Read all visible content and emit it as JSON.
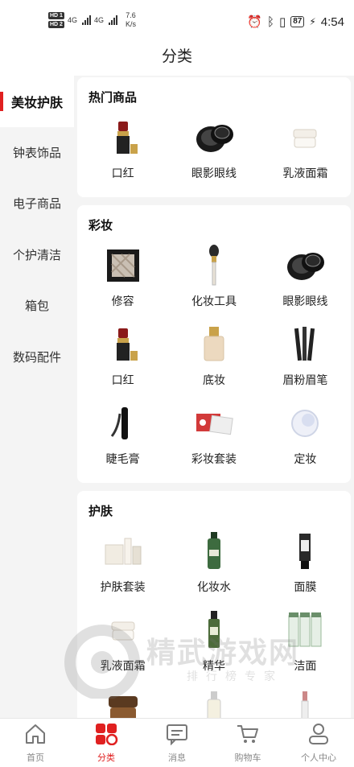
{
  "status_bar": {
    "hd1": "HD 1",
    "hd2": "HD 2",
    "net1": "4G",
    "net2": "4G",
    "speed_value": "7.6",
    "speed_unit": "K/s",
    "battery": "87",
    "time": "4:54"
  },
  "header": {
    "title": "分类"
  },
  "sidebar": {
    "items": [
      {
        "label": "美妆护肤",
        "active": true
      },
      {
        "label": "钟表饰品"
      },
      {
        "label": "电子商品"
      },
      {
        "label": "个护清洁"
      },
      {
        "label": "箱包"
      },
      {
        "label": "数码配件"
      }
    ]
  },
  "sections": [
    {
      "title": "热门商品",
      "items": [
        {
          "label": "口红",
          "icon": "lipstick-icon"
        },
        {
          "label": "眼影眼线",
          "icon": "eyeshadow-jar-icon"
        },
        {
          "label": "乳液面霜",
          "icon": "cream-jar-icon"
        }
      ]
    },
    {
      "title": "彩妆",
      "items": [
        {
          "label": "修容",
          "icon": "contour-palette-icon"
        },
        {
          "label": "化妆工具",
          "icon": "makeup-brush-icon"
        },
        {
          "label": "眼影眼线",
          "icon": "eyeshadow-jar-icon"
        },
        {
          "label": "口红",
          "icon": "lipstick-icon"
        },
        {
          "label": "底妆",
          "icon": "foundation-bottle-icon"
        },
        {
          "label": "眉粉眉笔",
          "icon": "brow-pencils-icon"
        },
        {
          "label": "睫毛膏",
          "icon": "mascara-icon"
        },
        {
          "label": "彩妆套装",
          "icon": "makeup-set-icon"
        },
        {
          "label": "定妆",
          "icon": "powder-puff-icon"
        }
      ]
    },
    {
      "title": "护肤",
      "items": [
        {
          "label": "护肤套装",
          "icon": "skincare-set-icon"
        },
        {
          "label": "化妆水",
          "icon": "toner-bottle-icon"
        },
        {
          "label": "面膜",
          "icon": "mask-tube-icon"
        },
        {
          "label": "乳液面霜",
          "icon": "cream-jar-icon"
        },
        {
          "label": "精华",
          "icon": "serum-bottle-icon"
        },
        {
          "label": "洁面",
          "icon": "cleanser-bottles-icon"
        },
        {
          "label": "",
          "icon": "night-cream-jar-icon"
        },
        {
          "label": "",
          "icon": "oil-bottle-icon"
        },
        {
          "label": "",
          "icon": "slim-tube-icon"
        }
      ]
    }
  ],
  "tabbar": {
    "tabs": [
      {
        "label": "首页",
        "icon": "home-icon"
      },
      {
        "label": "分类",
        "icon": "category-icon",
        "active": true
      },
      {
        "label": "消息",
        "icon": "message-icon"
      },
      {
        "label": "购物车",
        "icon": "cart-icon"
      },
      {
        "label": "个人中心",
        "icon": "user-icon"
      }
    ]
  },
  "watermark": {
    "main": "精武游戏网",
    "sub": "排行榜专家"
  },
  "colors": {
    "accent": "#e02020"
  }
}
